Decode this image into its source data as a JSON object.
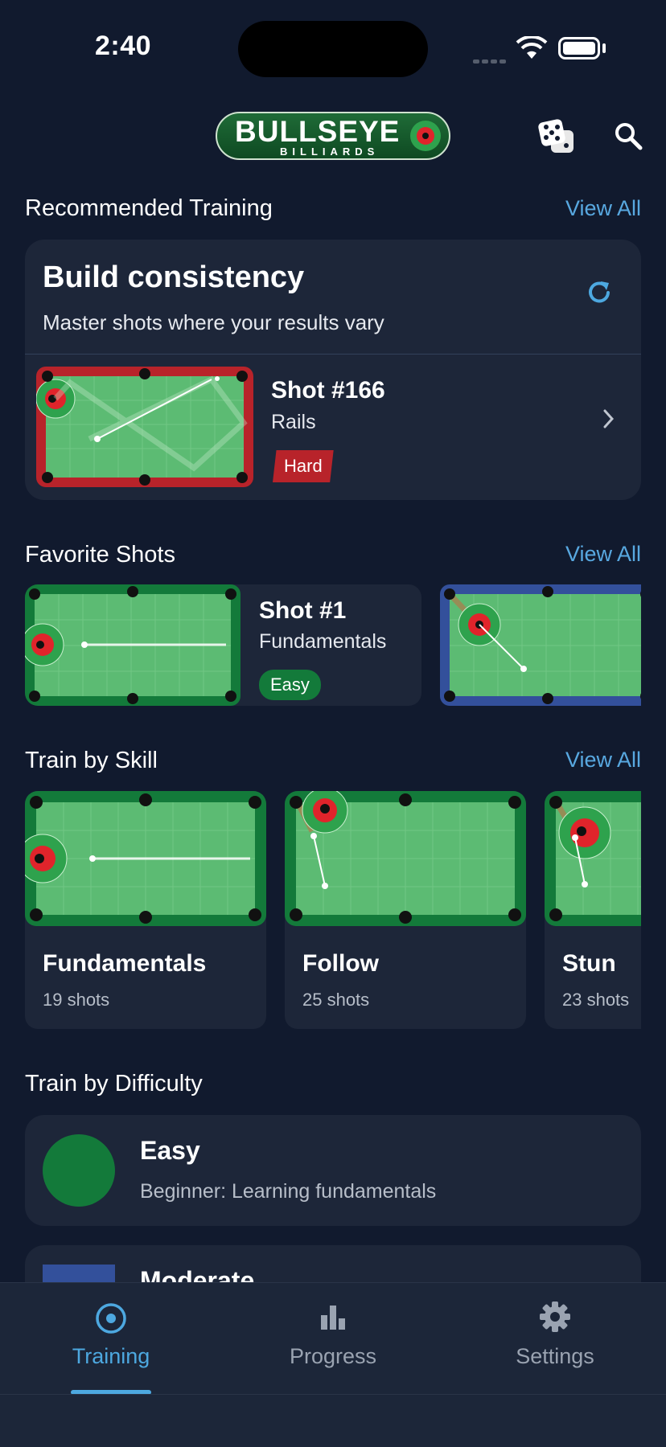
{
  "status": {
    "time": "2:40"
  },
  "header": {
    "logo_main": "BULLSEYE",
    "logo_sub": "BILLIARDS"
  },
  "icons": {
    "dice": "dice-icon",
    "search": "search-icon",
    "refresh": "refresh-icon",
    "chevron": "chevron-right-icon"
  },
  "recommended": {
    "title": "Recommended Training",
    "view_all": "View All",
    "card_title": "Build consistency",
    "card_subtitle": "Master shots where your results vary",
    "shot": {
      "name": "Shot #166",
      "category": "Rails",
      "difficulty": "Hard"
    }
  },
  "favorites": {
    "title": "Favorite Shots",
    "view_all": "View All",
    "items": [
      {
        "name": "Shot #1",
        "category": "Fundamentals",
        "difficulty": "Easy"
      }
    ]
  },
  "skills": {
    "title": "Train by Skill",
    "view_all": "View All",
    "items": [
      {
        "name": "Fundamentals",
        "count": "19 shots"
      },
      {
        "name": "Follow",
        "count": "25 shots"
      },
      {
        "name": "Stun",
        "count": "23 shots"
      }
    ]
  },
  "difficulty": {
    "title": "Train by Difficulty",
    "items": [
      {
        "name": "Easy",
        "description": "Beginner: Learning fundamentals",
        "color": "#137a3a"
      },
      {
        "name": "Moderate",
        "description": "",
        "color": "#33509b"
      }
    ]
  },
  "tabs": [
    {
      "label": "Training",
      "active": true
    },
    {
      "label": "Progress",
      "active": false
    },
    {
      "label": "Settings",
      "active": false
    }
  ],
  "colors": {
    "accent": "#4da8e0",
    "hard": "#b8232a",
    "easy": "#137a3a",
    "felt": "#5cbb73",
    "rail_green": "#137a3a",
    "rail_red": "#b8232a",
    "rail_blue": "#33509b"
  }
}
